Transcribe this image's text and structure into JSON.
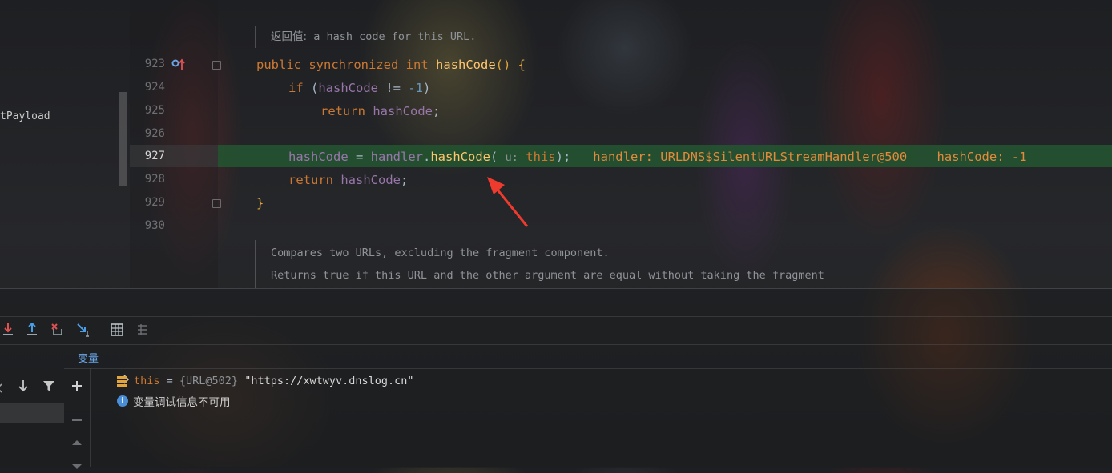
{
  "project": {
    "item_label": "tPayload"
  },
  "gutter": {
    "line_numbers": [
      "923",
      "924",
      "925",
      "926",
      "927",
      "928",
      "929",
      "930"
    ]
  },
  "doc_top": {
    "label": "返回值:",
    "text": "a hash code for this URL."
  },
  "code": {
    "l923": {
      "kw1": "public",
      "kw2": "synchronized",
      "kw3": "int",
      "fn": "hashCode",
      "tail": "() {"
    },
    "l924": {
      "kw": "if",
      "open": " (",
      "fld": "hashCode",
      "op": " != ",
      "num": "-1",
      "close": ")"
    },
    "l925": {
      "kw": "return",
      "fld": "hashCode",
      "semi": ";"
    },
    "l927": {
      "fld": "hashCode",
      "eq": " = ",
      "obj": "handler",
      "dot": ".",
      "fn": "hashCode",
      "paren": "(",
      "hint": "u:",
      "arg": "this",
      "end": ");",
      "debug1": "handler: URLDNS$SilentURLStreamHandler@500",
      "debug2": "hashCode: -1"
    },
    "l928": {
      "kw": "return",
      "fld": "hashCode",
      "semi": ";"
    },
    "l929": {
      "brace": "}"
    }
  },
  "doc_bottom": {
    "line1": "Compares two URLs, excluding the fragment component.",
    "line2": "Returns true if this URL and the other argument are equal without taking the fragment"
  },
  "debugger": {
    "variables_tab": "变量",
    "var": {
      "name": "this",
      "eq": " = ",
      "ref": "{URL@502}",
      "value": " \"https://xwtwyv.dnslog.cn\""
    },
    "info": "变量调试信息不可用"
  },
  "colors": {
    "exec_line": "#245230",
    "accent_blue": "#6aa6e6",
    "keyword": "#cc7832",
    "field": "#9876aa",
    "method": "#ffc66d"
  }
}
